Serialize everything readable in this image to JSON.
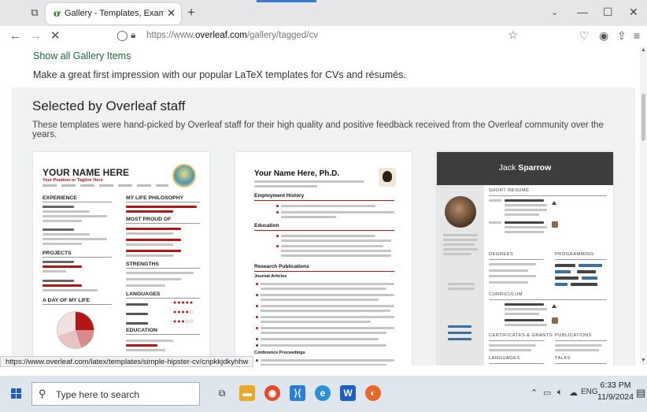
{
  "browser": {
    "tab_title": "Gallery - Templates, Examples a",
    "tab_favicon": "overleaf-leaf-icon",
    "url_prefix": "https://www.",
    "url_domain": "overleaf.com",
    "url_path": "/gallery/tagged/cv",
    "accent_color": "#3a7bd5"
  },
  "page": {
    "show_all_link": "Show all Gallery Items",
    "intro": "Make a great first impression with our popular LaTeX templates for CVs and résumés.",
    "staff_heading": "Selected by Overleaf staff",
    "staff_subtitle": "These templates were hand-picked by Overleaf staff for their high quality and positive feedback received from the Overleaf community over the years.",
    "brand_green": "#1a6b39"
  },
  "cards": [
    {
      "name": "YOUR NAME HERE",
      "position": "Your Position or Tagline Here",
      "sections": [
        "EXPERIENCE",
        "MY LIFE PHILOSOPHY",
        "MOST PROUD OF",
        "PROJECTS",
        "STRENGTHS",
        "LANGUAGES",
        "A DAY OF MY LIFE",
        "EDUCATION"
      ],
      "languages": [
        "English",
        "Spanish",
        "German"
      ],
      "accent_color": "#b01818"
    },
    {
      "name": "Your Name Here, Ph.D.",
      "sections": [
        "Employment History",
        "Education",
        "Research Publications",
        "Journal Articles",
        "Conference Proceedings"
      ]
    },
    {
      "name_first": "Jack",
      "name_last": "Sparrow",
      "sections": [
        "SHORT RESUMÉ",
        "DEGREES",
        "PROGRAMMING",
        "CURRICULUM",
        "CERTIFICATES & GRANTS",
        "PUBLICATIONS",
        "LANGUAGES",
        "TALKS"
      ]
    }
  ],
  "status_url": "https://www.overleaf.com/latex/templates/simple-hipster-cv/cnpkkjdkyhhw",
  "taskbar": {
    "search_placeholder": "Type here to search",
    "lang": "ENG",
    "time": "6:33 PM",
    "date": "11/9/2024"
  }
}
